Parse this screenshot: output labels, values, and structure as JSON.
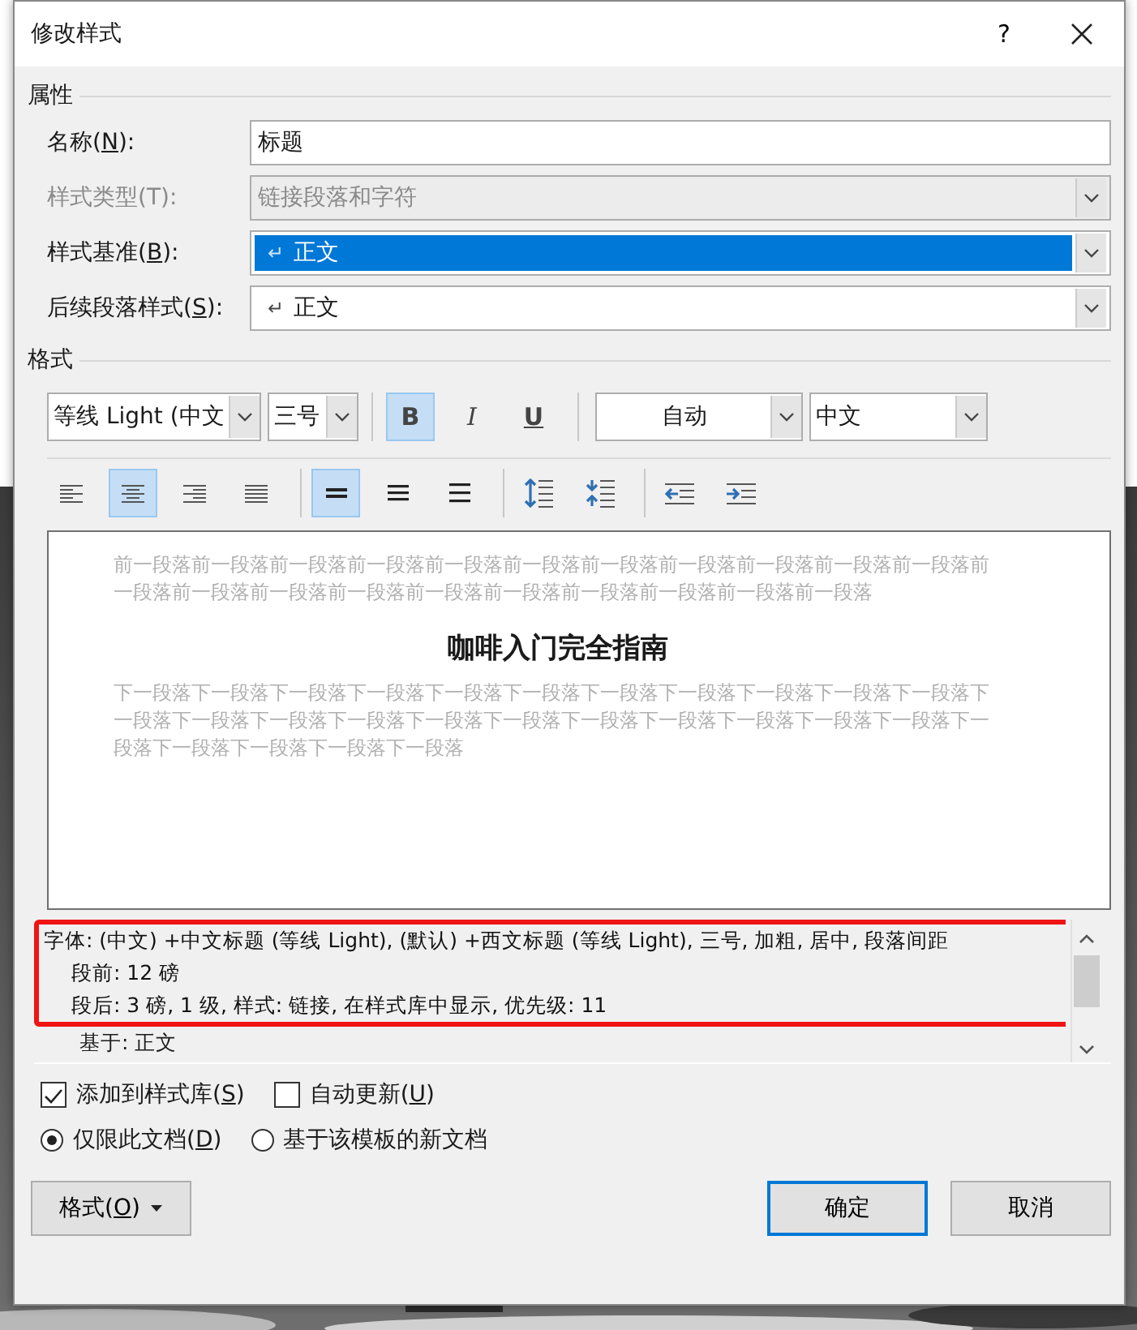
{
  "window": {
    "title": "修改样式",
    "help": "?"
  },
  "properties": {
    "heading": "属性",
    "rows": [
      {
        "kind": "text",
        "label": [
          "名称(",
          "N",
          "):"
        ],
        "value": "标题"
      },
      {
        "kind": "select",
        "label": [
          "样式类型(T):"
        ],
        "value": "链接段落和字符",
        "disabled": true,
        "selected": false
      },
      {
        "kind": "select",
        "label": [
          "样式基准(",
          "B",
          "):"
        ],
        "value": "正文",
        "disabled": false,
        "selected": true,
        "mark": "↵"
      },
      {
        "kind": "select",
        "label": [
          "后续段落样式(",
          "S",
          "):"
        ],
        "value": "正文",
        "disabled": false,
        "selected": false,
        "mark": "↵"
      }
    ]
  },
  "format": {
    "heading": "格式",
    "font": "等线 Light (中文",
    "size": "三号",
    "styles": [
      {
        "kind": "bold",
        "label": "B",
        "selected": true
      },
      {
        "kind": "italic",
        "label": "I",
        "selected": false
      },
      {
        "kind": "underline",
        "label": "U",
        "selected": false
      }
    ],
    "text_color": "自动",
    "language": "中文",
    "align": [
      {
        "kind": "left",
        "selected": false
      },
      {
        "kind": "center",
        "selected": true
      },
      {
        "kind": "right",
        "selected": false
      },
      {
        "kind": "justify",
        "selected": false
      }
    ],
    "spacing": [
      {
        "kind": "single",
        "selected": true
      },
      {
        "kind": "onehalf",
        "selected": false
      },
      {
        "kind": "double",
        "selected": false
      }
    ],
    "para": [
      {
        "kind": "increase"
      },
      {
        "kind": "decrease"
      }
    ],
    "indent": [
      {
        "kind": "outdent"
      },
      {
        "kind": "indent"
      }
    ]
  },
  "preview": {
    "before": "前一段落前一段落前一段落前一段落前一段落前一段落前一段落前一段落前一段落前一段落前一段落前一段落前一段落前一段落前一段落前一段落前一段落前一段落前一段落前一段落前一段落",
    "title": "咖啡入门完全指南",
    "after": "下一段落下一段落下一段落下一段落下一段落下一段落下一段落下一段落下一段落下一段落下一段落下一段落下一段落下一段落下一段落下一段落下一段落下一段落下一段落下一段落下一段落下一段落下一段落下一段落下一段落下一段落下一段落"
  },
  "description": {
    "lines": [
      {
        "kind": "head",
        "text": "字体: (中文) +中文标题 (等线 Light), (默认) +西文标题 (等线 Light), 三号, 加粗, 居中, 段落间距",
        "highlight": true
      },
      {
        "kind": "detail",
        "text": "段前: 12 磅",
        "highlight": true
      },
      {
        "kind": "detail",
        "text": "段后: 3 磅, 1 级, 样式: 链接, 在样式库中显示, 优先级: 11",
        "highlight": true
      },
      {
        "kind": "detail",
        "text": "基于: 正文",
        "highlight": false
      }
    ]
  },
  "checks": [
    {
      "label": [
        "添加到样式库(",
        "S",
        ")"
      ],
      "checked": true
    },
    {
      "label": [
        "自动更新(",
        "U",
        ")"
      ],
      "checked": false
    }
  ],
  "radios": [
    {
      "label": [
        "仅限此文档(",
        "D",
        ")"
      ],
      "selected": true
    },
    {
      "label": [
        "基于该模板的新文档"
      ],
      "selected": false
    }
  ],
  "buttons": {
    "format": [
      "格式(",
      "O",
      ")"
    ],
    "ok": "确定",
    "cancel": "取消"
  }
}
